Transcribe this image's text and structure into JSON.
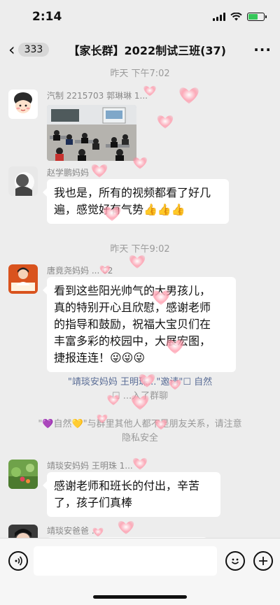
{
  "status_bar": {
    "time": "2:14"
  },
  "nav": {
    "back_count": "333",
    "title": "【家长群】2022制试三班(37)",
    "more_label": "···"
  },
  "chat": {
    "time1": "昨天 下午7:02",
    "msg1": {
      "sender": "汽制 2215703 郭琳琳 1..."
    },
    "msg2": {
      "sender": "赵学鹏妈妈",
      "text_line1": "我也是，所有的视频都看了好几",
      "text_line2": "遍，感觉好有气势👍👍👍"
    },
    "time2": "昨天 下午9:02",
    "msg3": {
      "sender": "唐竟尧妈妈 ... 62",
      "lines": [
        "看到这些阳光帅气的大男孩儿，",
        "真的特别开心且欣慰，感谢老师",
        "的指导和鼓励，祝福大宝贝们在",
        "丰富多彩的校园中，大展宏图，",
        "捷报连连！😜😜😜"
      ]
    },
    "system1": {
      "part1": "\"靖琰安妈妈",
      "part2": "王明珠...\"邀请\"☐ 自然",
      "part3": "☐ ...入了群聊"
    },
    "system2": {
      "line1": "\"💜自然💛\"与群里其他人都不是朋友关系，请注意",
      "line2": "隐私安全"
    },
    "msg4": {
      "sender": "靖琰安妈妈   王明珠 1...",
      "text_line1": "感谢老师和班长的付出，辛苦",
      "text_line2": "了，孩子们真棒"
    },
    "msg5": {
      "sender": "靖琰安爸爸 ..."
    }
  },
  "colors": {
    "background": "#ededed",
    "bubble": "#ffffff",
    "system_link": "#5a6d96",
    "time_text": "#9a9a9a"
  }
}
